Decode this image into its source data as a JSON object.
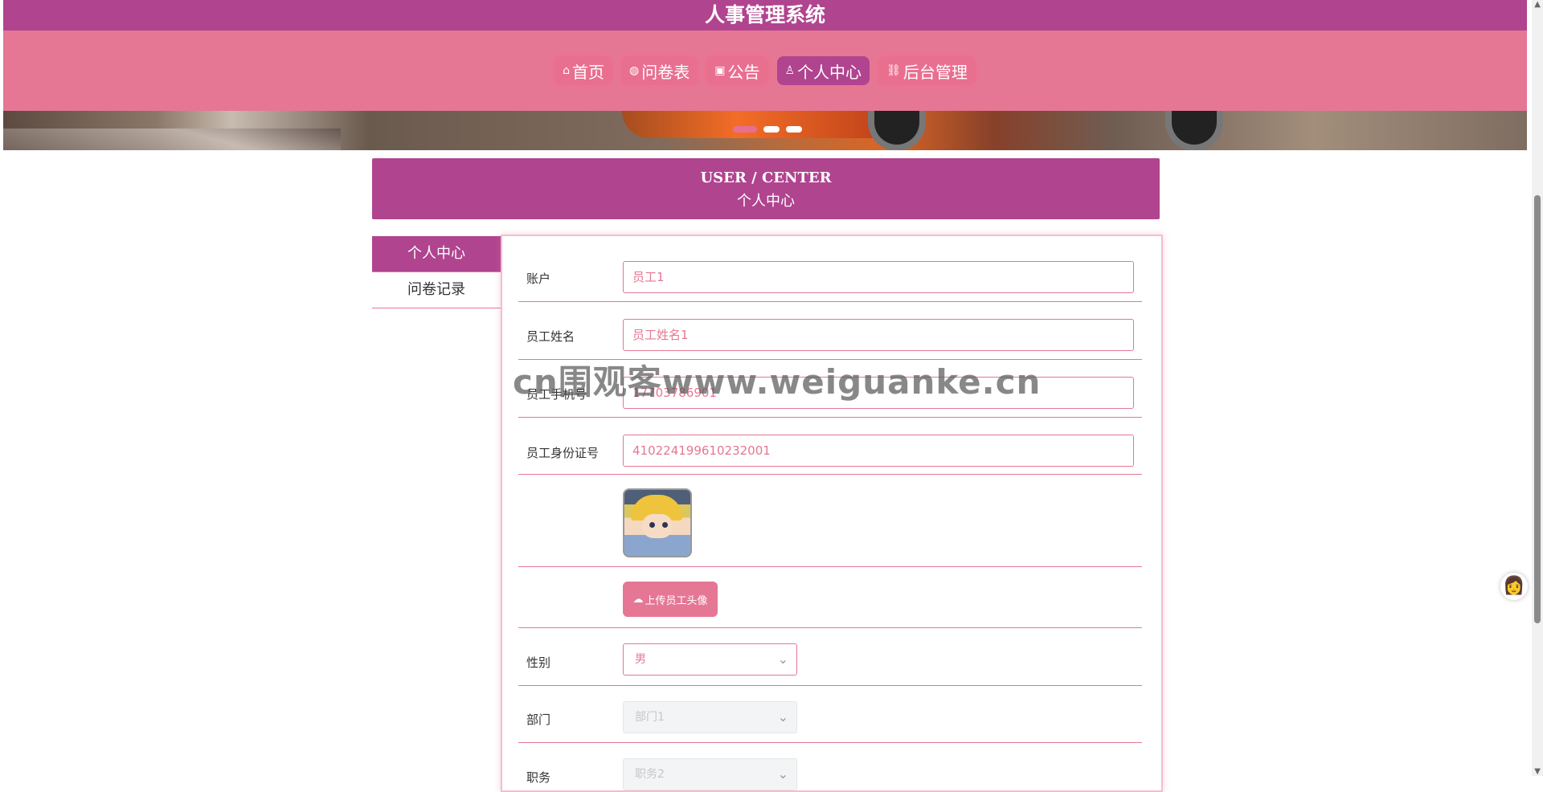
{
  "header": {
    "title": "人事管理系统"
  },
  "nav": [
    {
      "icon": "home-icon",
      "label": "首页",
      "icon_glyph": "⌂"
    },
    {
      "icon": "globe-icon",
      "label": "问卷表",
      "icon_glyph": "◍"
    },
    {
      "icon": "notice-icon",
      "label": "公告",
      "icon_glyph": "▣"
    },
    {
      "icon": "user-icon",
      "label": "个人中心",
      "icon_glyph": "♙",
      "active": true
    },
    {
      "icon": "link-icon",
      "label": "后台管理",
      "icon_glyph": "⛓"
    }
  ],
  "section": {
    "en_title": "USER / CENTER",
    "cn_title": "个人中心"
  },
  "side_menu": [
    {
      "label": "个人中心",
      "active": true
    },
    {
      "label": "问卷记录",
      "active": false
    }
  ],
  "form": {
    "account_label": "账户",
    "account_value": "员工1",
    "name_label": "员工姓名",
    "name_value": "员工姓名1",
    "phone_label": "员工手机号",
    "phone_value": "17703786901",
    "id_label": "员工身份证号",
    "id_value": "410224199610232001",
    "upload_label": "上传员工头像",
    "gender_label": "性别",
    "gender_value": "男",
    "department_label": "部门",
    "department_value": "部门1",
    "position_label": "职务",
    "position_value": "职务2"
  },
  "watermark": "cn围观客www.weiguanke.cn",
  "colors": {
    "primary": "#b0448f",
    "accent": "#e57794"
  },
  "assistant": {
    "icon": "avatar-assistant-icon"
  }
}
